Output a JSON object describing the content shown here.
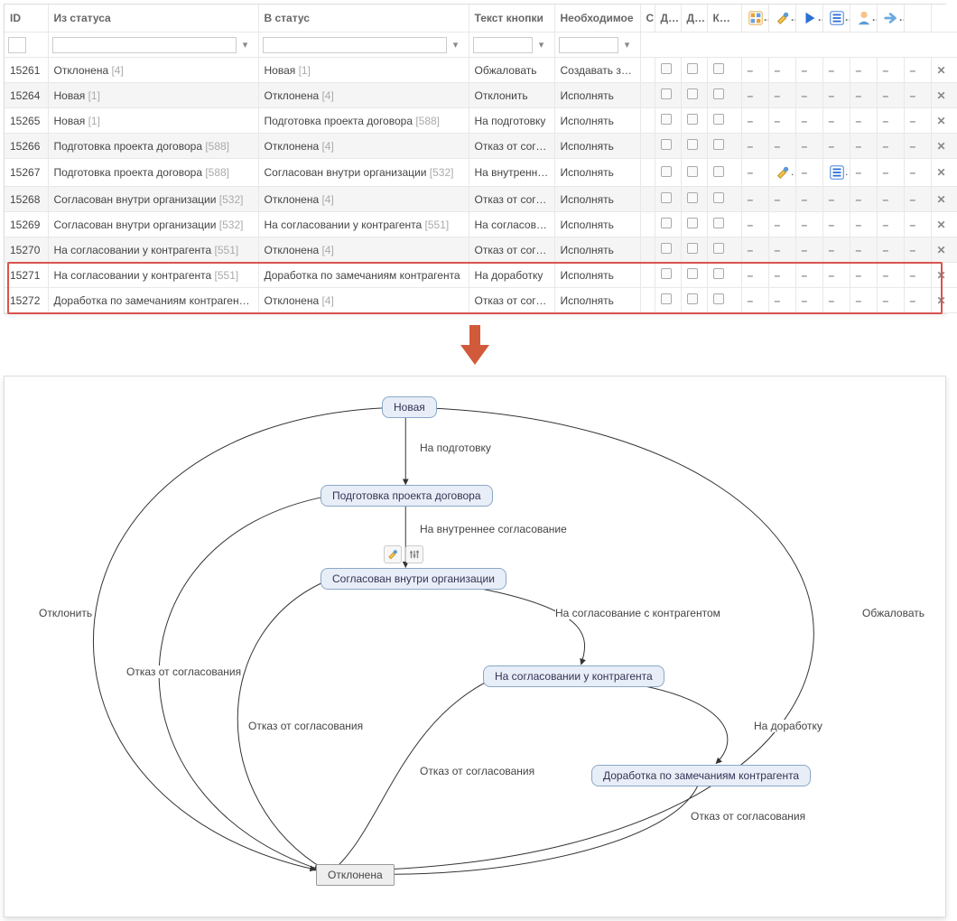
{
  "columns": {
    "id": "ID",
    "from_status": "Из статуса",
    "to_status": "В статус",
    "button_text": "Текст кнопки",
    "required": "Необходимое",
    "c": "С",
    "for1": "Для",
    "for2": "Для",
    "btn": "Кноп"
  },
  "rows": [
    {
      "id": "15261",
      "from": "Отклонена",
      "from_code": "[4]",
      "to": "Новая",
      "to_code": "[1]",
      "btn": "Обжаловать",
      "req": "Создавать задач",
      "icons": [
        "-",
        "-",
        "-",
        "-",
        "-",
        "-",
        "-"
      ]
    },
    {
      "id": "15264",
      "from": "Новая",
      "from_code": "[1]",
      "to": "Отклонена",
      "to_code": "[4]",
      "btn": "Отклонить",
      "req": "Исполнять",
      "icons": [
        "-",
        "-",
        "-",
        "-",
        "-",
        "-",
        "-"
      ]
    },
    {
      "id": "15265",
      "from": "Новая",
      "from_code": "[1]",
      "to": "Подготовка проекта договора",
      "to_code": "[588]",
      "btn": "На подготовку",
      "req": "Исполнять",
      "icons": [
        "-",
        "-",
        "-",
        "-",
        "-",
        "-",
        "-"
      ]
    },
    {
      "id": "15266",
      "from": "Подготовка проекта договора",
      "from_code": "[588]",
      "to": "Отклонена",
      "to_code": "[4]",
      "btn": "Отказ от соглас",
      "req": "Исполнять",
      "icons": [
        "-",
        "-",
        "-",
        "-",
        "-",
        "-",
        "-"
      ]
    },
    {
      "id": "15267",
      "from": "Подготовка проекта договора",
      "from_code": "[588]",
      "to": "Согласован внутри организации",
      "to_code": "[532]",
      "btn": "На внутреннее",
      "req": "Исполнять",
      "icons": [
        "-",
        "brush",
        "-",
        "list",
        "-",
        "-",
        "-"
      ]
    },
    {
      "id": "15268",
      "from": "Согласован внутри организации",
      "from_code": "[532]",
      "to": "Отклонена",
      "to_code": "[4]",
      "btn": "Отказ от соглас",
      "req": "Исполнять",
      "icons": [
        "-",
        "-",
        "-",
        "-",
        "-",
        "-",
        "-"
      ]
    },
    {
      "id": "15269",
      "from": "Согласован внутри организации",
      "from_code": "[532]",
      "to": "На согласовании у контрагента",
      "to_code": "[551]",
      "btn": "На согласовани",
      "req": "Исполнять",
      "icons": [
        "-",
        "-",
        "-",
        "-",
        "-",
        "-",
        "-"
      ]
    },
    {
      "id": "15270",
      "from": "На согласовании у контрагента",
      "from_code": "[551]",
      "to": "Отклонена",
      "to_code": "[4]",
      "btn": "Отказ от соглас",
      "req": "Исполнять",
      "icons": [
        "-",
        "-",
        "-",
        "-",
        "-",
        "-",
        "-"
      ]
    },
    {
      "id": "15271",
      "from": "На согласовании у контрагента",
      "from_code": "[551]",
      "to": "Доработка по замечаниям контрагента",
      "to_code": "",
      "btn": "На доработку",
      "req": "Исполнять",
      "icons": [
        "-",
        "-",
        "-",
        "-",
        "-",
        "-",
        "-"
      ],
      "highlight": true
    },
    {
      "id": "15272",
      "from": "Доработка по замечаниям контрагента",
      "from_code": "[",
      "to": "Отклонена",
      "to_code": "[4]",
      "btn": "Отказ от соглас",
      "req": "Исполнять",
      "icons": [
        "-",
        "-",
        "-",
        "-",
        "-",
        "-",
        "-"
      ],
      "highlight": true
    }
  ],
  "header_icons": [
    "layout-icon",
    "brush-icon",
    "play-icon",
    "list-icon",
    "user-icon",
    "forward-icon"
  ],
  "diagram": {
    "nodes": {
      "new": "Новая",
      "prep": "Подготовка проекта договора",
      "inner": "Согласован внутри организации",
      "counter": "На согласовании у контрагента",
      "rework": "Доработка по замечаниям контрагента",
      "rejected": "Отклонена"
    },
    "edges": {
      "to_prep": "На подготовку",
      "to_inner": "На внутреннее согласование",
      "to_counter": "На согласование с контрагентом",
      "to_rework": "На доработку",
      "reject": "Отклонить",
      "appeal": "Обжаловать",
      "refuse": "Отказ от согласования"
    }
  }
}
